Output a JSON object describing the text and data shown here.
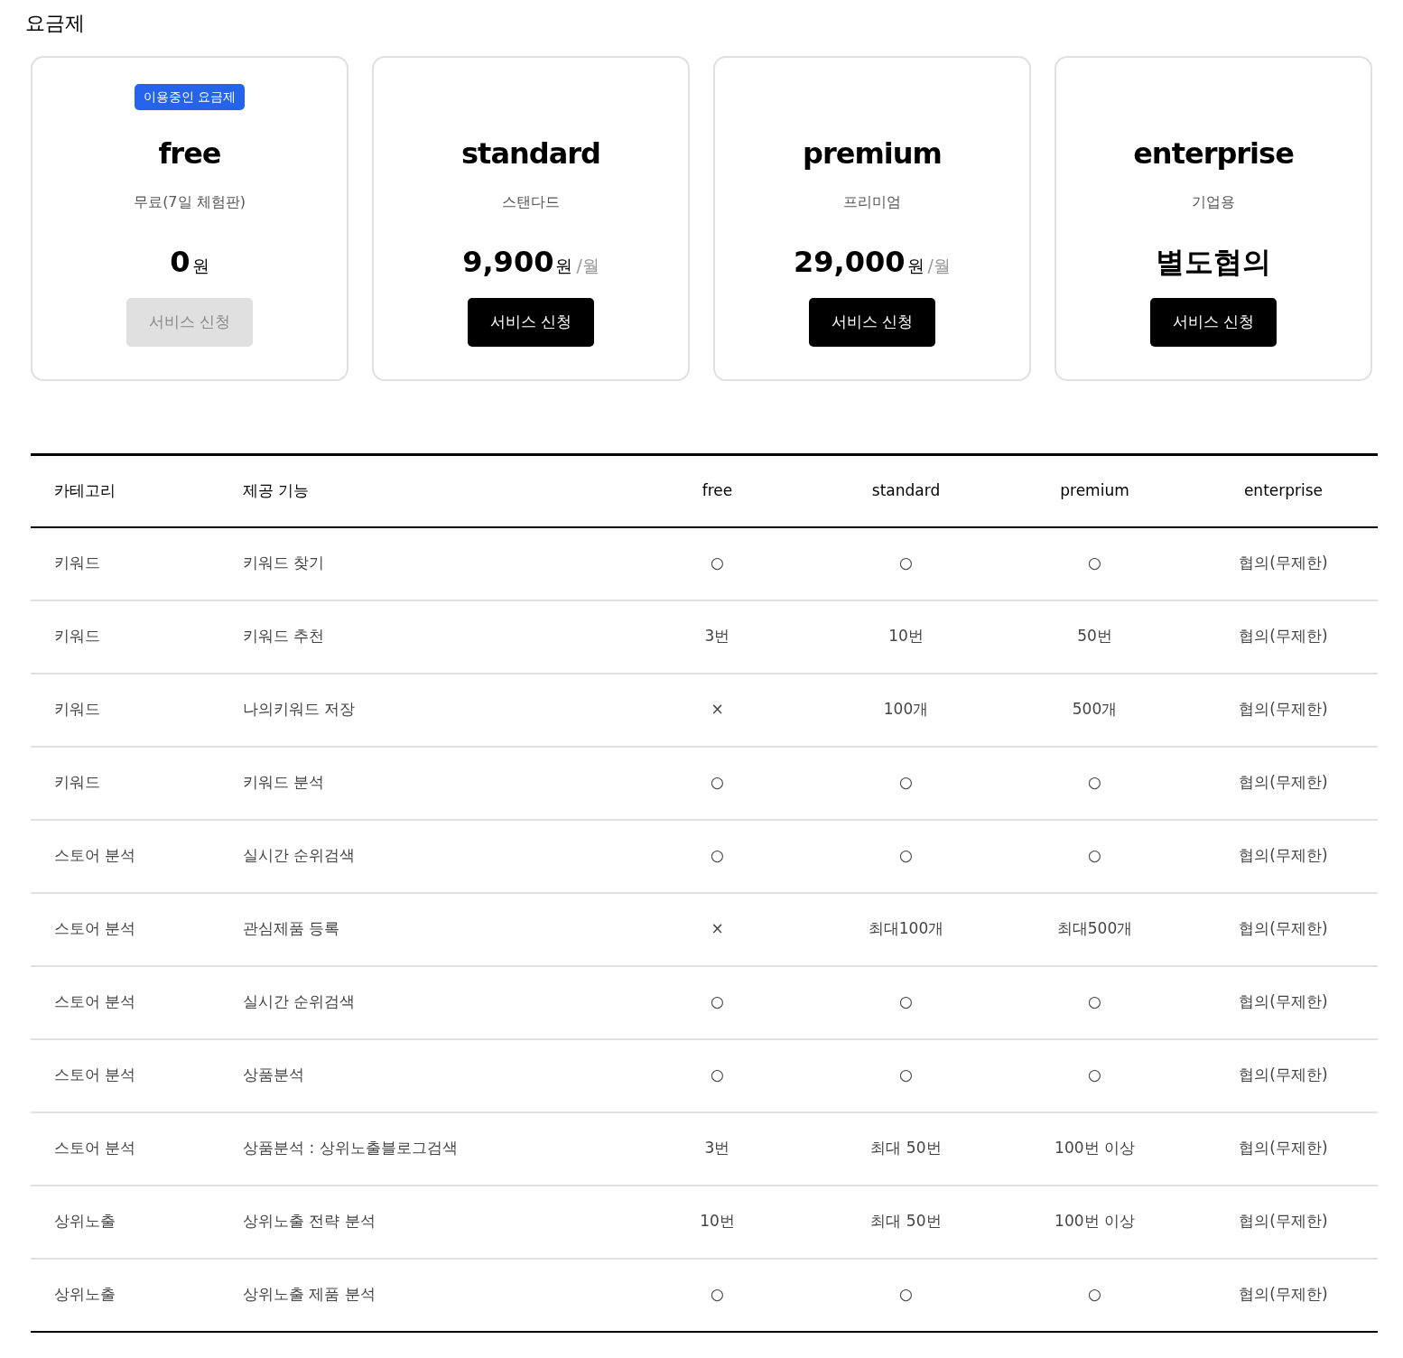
{
  "title": "요금제",
  "plans": [
    {
      "name": "free",
      "badge": "이용중인 요금제",
      "subtitle": "무료(7일 체험판)",
      "price": "0",
      "unit": "원",
      "button": {
        "label": "서비스 신청",
        "disabled": true
      }
    },
    {
      "name": "standard",
      "subtitle": "스탠다드",
      "price": "9,900",
      "unit": "원",
      "period": "/월",
      "button": {
        "label": "서비스 신청",
        "disabled": false
      }
    },
    {
      "name": "premium",
      "subtitle": "프리미엄",
      "price": "29,000",
      "unit": "원",
      "period": "/월",
      "button": {
        "label": "서비스 신청",
        "disabled": false
      }
    },
    {
      "name": "enterprise",
      "subtitle": "기업용",
      "price": "별도협의",
      "button": {
        "label": "서비스 신청",
        "disabled": false
      }
    }
  ],
  "table": {
    "columns": [
      "카테고리",
      "제공 기능",
      "free",
      "standard",
      "premium",
      "enterprise"
    ],
    "rows": [
      {
        "category": "키워드",
        "feature": "키워드 찾기",
        "values": [
          "○",
          "○",
          "○",
          "협의(무제한)"
        ]
      },
      {
        "category": "키워드",
        "feature": "키워드 추천",
        "values": [
          "3번",
          "10번",
          "50번",
          "협의(무제한)"
        ]
      },
      {
        "category": "키워드",
        "feature": "나의키워드 저장",
        "values": [
          "×",
          "100개",
          "500개",
          "협의(무제한)"
        ]
      },
      {
        "category": "키워드",
        "feature": "키워드 분석",
        "values": [
          "○",
          "○",
          "○",
          "협의(무제한)"
        ]
      },
      {
        "category": "스토어 분석",
        "feature": "실시간 순위검색",
        "values": [
          "○",
          "○",
          "○",
          "협의(무제한)"
        ]
      },
      {
        "category": "스토어 분석",
        "feature": "관심제품 등록",
        "values": [
          "×",
          "최대100개",
          "최대500개",
          "협의(무제한)"
        ]
      },
      {
        "category": "스토어 분석",
        "feature": "실시간 순위검색",
        "values": [
          "○",
          "○",
          "○",
          "협의(무제한)"
        ]
      },
      {
        "category": "스토어 분석",
        "feature": "상품분석",
        "values": [
          "○",
          "○",
          "○",
          "협의(무제한)"
        ]
      },
      {
        "category": "스토어 분석",
        "feature": "상품분석 : 상위노출블로그검색",
        "values": [
          "3번",
          "최대 50번",
          "100번 이상",
          "협의(무제한)"
        ]
      },
      {
        "category": "상위노출",
        "feature": "상위노출 전략 분석",
        "values": [
          "10번",
          "최대 50번",
          "100번 이상",
          "협의(무제한)"
        ]
      },
      {
        "category": "상위노출",
        "feature": "상위노출 제품 분석",
        "values": [
          "○",
          "○",
          "○",
          "협의(무제한)"
        ]
      }
    ]
  }
}
